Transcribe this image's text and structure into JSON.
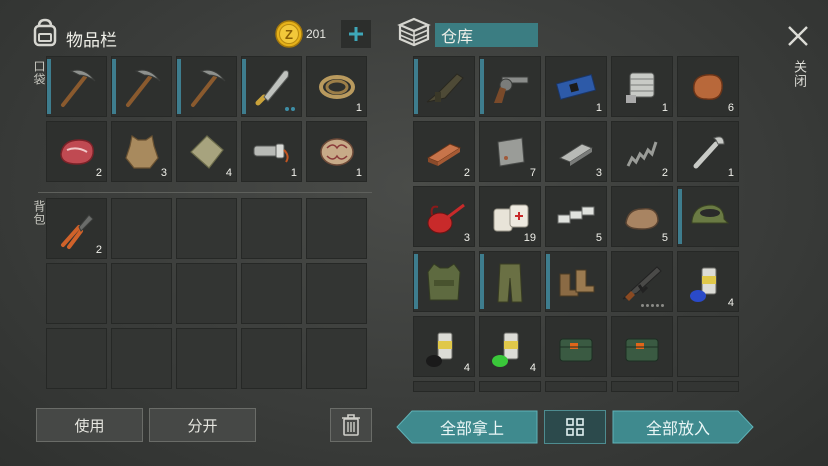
{
  "inventory": {
    "title": "物品栏",
    "coins": "201",
    "pocket_label": "口袋",
    "backpack_label": "背包",
    "pocket_slots": [
      {
        "icon": "pickaxe-icon",
        "count": "",
        "bar": true
      },
      {
        "icon": "pickaxe-icon",
        "count": "",
        "bar": true
      },
      {
        "icon": "pickaxe-icon",
        "count": "",
        "bar": true
      },
      {
        "icon": "machete-icon",
        "count": "",
        "bar": true,
        "dots": true
      },
      {
        "icon": "rope-icon",
        "count": "1"
      },
      {
        "icon": "raw-meat-icon",
        "count": "2"
      },
      {
        "icon": "animal-hide-icon",
        "count": "3"
      },
      {
        "icon": "cloth-icon",
        "count": "4"
      },
      {
        "icon": "flashlight-icon",
        "count": "1"
      },
      {
        "icon": "brain-icon",
        "count": "1"
      }
    ],
    "backpack_slots": [
      {
        "icon": "pliers-icon",
        "count": "2"
      }
    ],
    "use_label": "使用",
    "split_label": "分开"
  },
  "storage": {
    "title": "仓库",
    "slots": [
      {
        "icon": "grenade-launcher-icon",
        "count": "",
        "bar": true
      },
      {
        "icon": "revolver-icon",
        "count": "",
        "bar": true
      },
      {
        "icon": "circuit-board-icon",
        "count": "1"
      },
      {
        "icon": "engine-part-icon",
        "count": "1"
      },
      {
        "icon": "copper-ore-icon",
        "count": "6"
      },
      {
        "icon": "copper-ingot-icon",
        "count": "2"
      },
      {
        "icon": "metal-plate-icon",
        "count": "7"
      },
      {
        "icon": "iron-ingot-icon",
        "count": "3"
      },
      {
        "icon": "spring-icon",
        "count": "2"
      },
      {
        "icon": "wrench-icon",
        "count": "1"
      },
      {
        "icon": "oil-can-icon",
        "count": "3"
      },
      {
        "icon": "bandage-icon",
        "count": "19"
      },
      {
        "icon": "silver-bars-icon",
        "count": "5"
      },
      {
        "icon": "stone-icon",
        "count": "5"
      },
      {
        "icon": "camo-cap-icon",
        "count": "",
        "bar": true
      },
      {
        "icon": "camo-vest-icon",
        "count": "",
        "bar": true
      },
      {
        "icon": "camo-pants-icon",
        "count": "",
        "bar": true
      },
      {
        "icon": "boots-icon",
        "count": "",
        "bar": true
      },
      {
        "icon": "assault-rifle-icon",
        "count": "",
        "gdots": true
      },
      {
        "icon": "spray-paint-blue-icon",
        "count": "4"
      },
      {
        "icon": "spray-paint-black-icon",
        "count": "4"
      },
      {
        "icon": "spray-paint-green-icon",
        "count": "4"
      },
      {
        "icon": "explosive-case-icon",
        "count": ""
      },
      {
        "icon": "explosive-case-icon",
        "count": ""
      }
    ],
    "take_all_label": "全部拿上",
    "put_all_label": "全部放入"
  },
  "close_label": "关闭",
  "colors": {
    "accent_teal": "#3e8ea6",
    "button_teal": "#3f8a8e",
    "coin_gold": "#e6b21a"
  }
}
